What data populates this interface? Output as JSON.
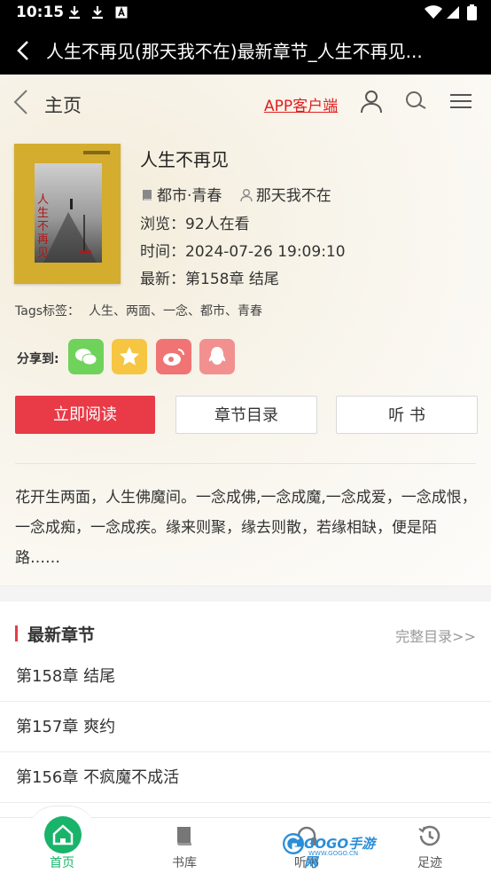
{
  "status_bar": {
    "time": "10:15"
  },
  "title_bar": {
    "title": "人生不再见(那天我不在)最新章节_人生不再见..."
  },
  "nav": {
    "home_label": "主页",
    "app_link": "APP客户端"
  },
  "book": {
    "name": "人生不再见",
    "category": "都市·青春",
    "author": "那天我不在",
    "views": "浏览：92人在看",
    "updated": "时间：2024-07-26 19:09:10",
    "latest": "最新：第158章 结尾",
    "cover_text": "人生不再见"
  },
  "tags": {
    "label": "Tags标签：",
    "value": "人生、两面、一念、都市、青春"
  },
  "share": {
    "label": "分享到:",
    "buttons": [
      "wechat-icon",
      "qzone-icon",
      "weibo-icon",
      "qq-icon"
    ]
  },
  "actions": {
    "read": "立即阅读",
    "toc": "章节目录",
    "listen": "听 书"
  },
  "description": "花开生两面，人生佛魔间。一念成佛,一念成魔,一念成爱，一念成恨，一念成痴，一念成疾。缘来则聚，缘去则散，若缘相缺，便是陌路……",
  "latest_chapters": {
    "heading": "最新章节",
    "more": "完整目录>>",
    "items": [
      "第158章 结尾",
      "第157章 爽约",
      "第156章 不疯魔不成活"
    ]
  },
  "tabbar": {
    "items": [
      {
        "label": "首页",
        "icon": "home-icon"
      },
      {
        "label": "书库",
        "icon": "book-library-icon"
      },
      {
        "label": "听书",
        "icon": "headphones-icon"
      },
      {
        "label": "足迹",
        "icon": "history-icon"
      }
    ]
  },
  "watermark": {
    "brand": "GOGO手游网",
    "url": "WWW.GOGO.CN"
  },
  "colors": {
    "accent": "#e83a47",
    "link": "#e02020",
    "home_active": "#19b36a",
    "wechat": "#6fd25b",
    "qzone": "#f6c642",
    "weibo": "#f07474",
    "qq": "#f29090"
  }
}
